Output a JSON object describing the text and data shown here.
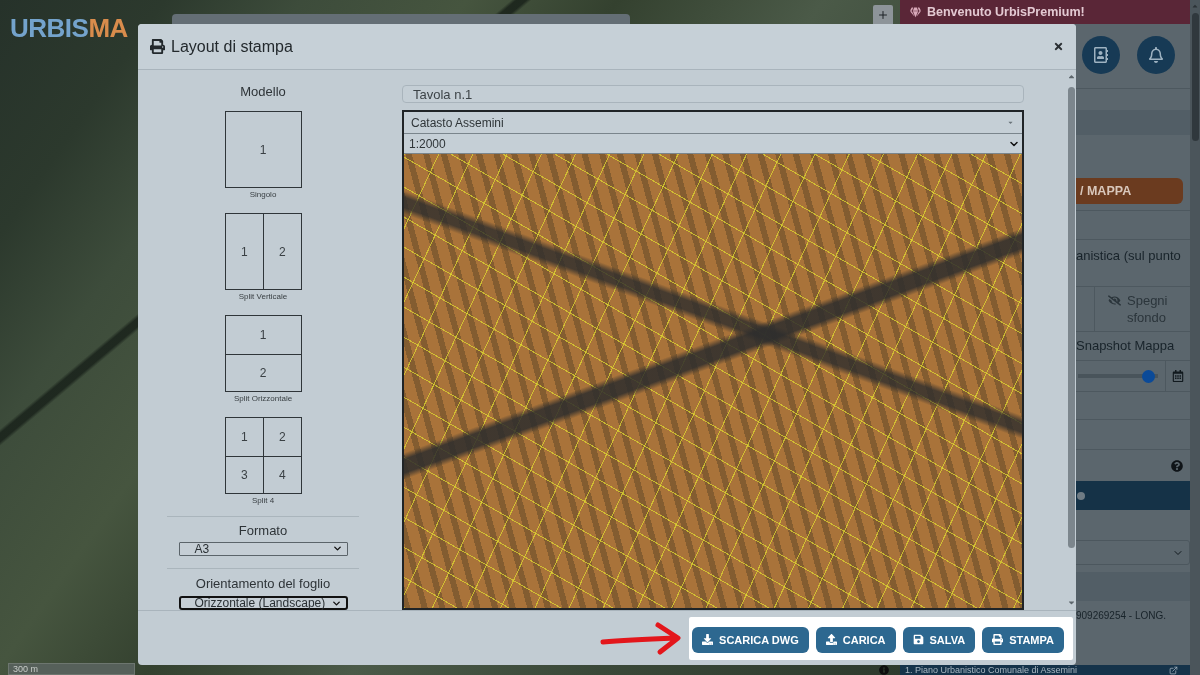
{
  "app": {
    "logo": {
      "primary": "URBIS",
      "accent": "MA"
    },
    "map_scale": "300 m",
    "banner": "Benvenuto UrbisPremium!",
    "side_panel": {
      "mode_button": "/ MAPPA",
      "info_text": "anistica (sul punto",
      "background_toggle": "Spegni sfondo",
      "snapshot_label": "Snapshot Mappa",
      "opacity_slider": {
        "level": 0.95
      },
      "coordinates": "909269254 - LONG.",
      "plan_link": "1. Piano Urbanistico Comunale di Assemini"
    }
  },
  "modal": {
    "title": "Layout di stampa",
    "template_section": {
      "heading": "Modello",
      "templates": [
        {
          "kind": "single",
          "caption": "Singolo",
          "cells": [
            "1"
          ]
        },
        {
          "kind": "vertical",
          "caption": "Split Verticale",
          "cells": [
            "1",
            "2"
          ]
        },
        {
          "kind": "horizontal",
          "caption": "Split Orizzontale",
          "cells": [
            "1",
            "2"
          ]
        },
        {
          "kind": "grid",
          "caption": "Split 4",
          "cells": [
            "1",
            "2",
            "3",
            "4"
          ]
        }
      ]
    },
    "format": {
      "label": "Formato",
      "value": "A3",
      "focused": false
    },
    "orientation": {
      "label": "Orientamento del foglio",
      "value": "Orizzontale (Landscape)",
      "focused": true
    },
    "sheet_title": {
      "value": "Tavola n.1"
    },
    "layer_select": {
      "value": "Catasto Assemini"
    },
    "scale_select": {
      "value": "1:2000"
    },
    "buttons": [
      {
        "kind": "download",
        "label": "SCARICA DWG"
      },
      {
        "kind": "upload",
        "label": "CARICA"
      },
      {
        "kind": "save",
        "label": "SALVA"
      },
      {
        "kind": "print",
        "label": "STAMPA"
      }
    ]
  }
}
